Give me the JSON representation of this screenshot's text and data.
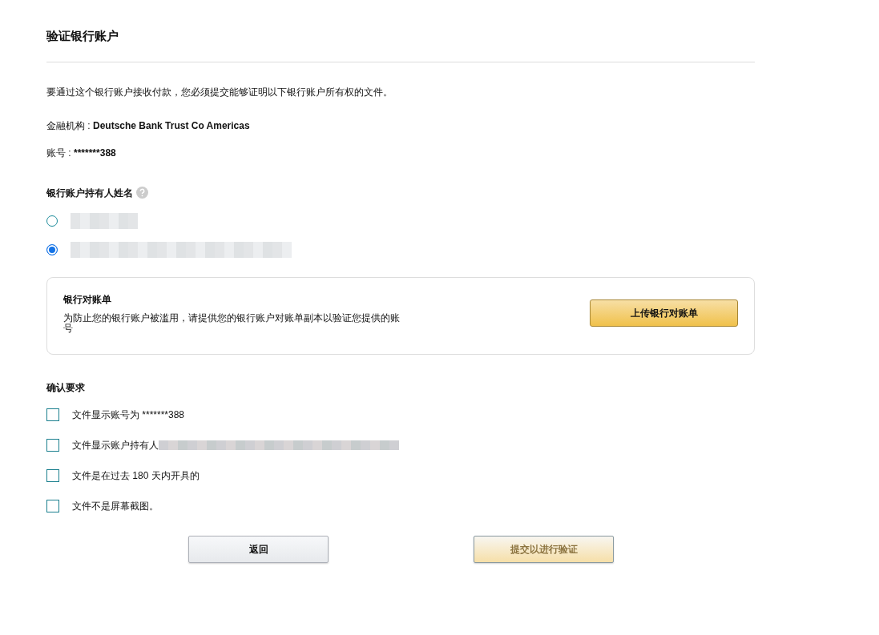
{
  "title": "验证银行账户",
  "intro": "要通过这个银行账户接收付款，您必须提交能够证明以下银行账户所有权的文件。",
  "details": [
    {
      "label": "金融机构 : ",
      "value": "Deutsche Bank Trust Co Americas"
    },
    {
      "label": "账号 : ",
      "value": "*******388"
    }
  ],
  "holder": {
    "label": "银行账户持有人姓名",
    "options": [
      {
        "selected": false
      },
      {
        "selected": true
      }
    ]
  },
  "statement": {
    "title": "银行对账单",
    "text": "为防止您的银行账户被滥用，请提供您的银行账户对账单副本以验证您提供的账号",
    "button": "上传银行对账单"
  },
  "requirements": {
    "title": "确认要求",
    "items": [
      {
        "label": "文件显示账号为 *******388",
        "checked": false,
        "redacted": false
      },
      {
        "label": "文件显示账户持有人",
        "checked": false,
        "redacted": true
      },
      {
        "label": "文件是在过去 180 天内开具的",
        "checked": false,
        "redacted": false
      },
      {
        "label": "文件不是屏幕截图。",
        "checked": false,
        "redacted": false
      }
    ]
  },
  "buttons": {
    "back": {
      "label": "返回"
    },
    "submit": {
      "label": "提交以进行验证",
      "disabled": true
    }
  }
}
